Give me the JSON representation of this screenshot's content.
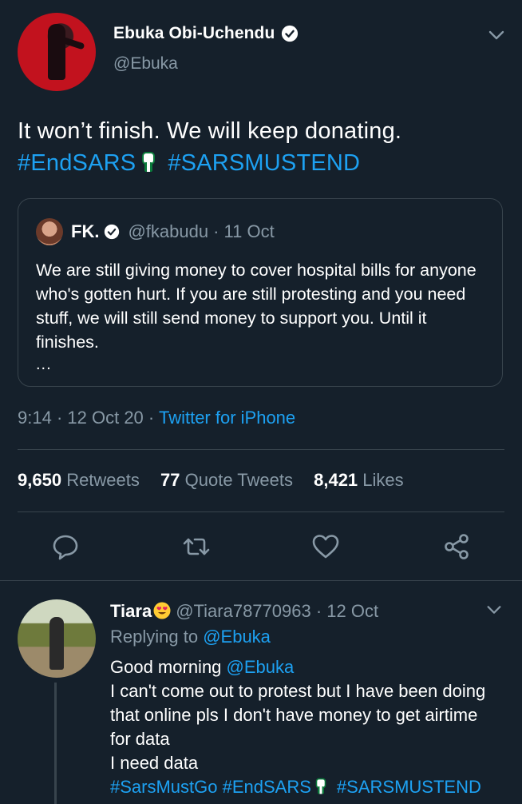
{
  "tweet": {
    "display_name": "Ebuka Obi-Uchendu",
    "handle": "@Ebuka",
    "text_line1": "It won’t finish. We will keep donating.",
    "hashtag1": "#EndSARS",
    "hashtag2": "#SARSMUSTEND",
    "time": "9:14",
    "date": "12 Oct 20",
    "sep": "·",
    "client": "Twitter for iPhone"
  },
  "quote": {
    "name": "FK.",
    "handle": "@fkabudu",
    "date": "· 11 Oct",
    "body": "We are still giving money to cover hospital bills for anyone who's gotten hurt. If you are still protesting and you need stuff, we will still send money to support you. Until it finishes.",
    "ellipsis": "..."
  },
  "stats": {
    "retweets_count": "9,650",
    "retweets_label": "Retweets",
    "quotes_count": "77",
    "quotes_label": "Quote Tweets",
    "likes_count": "8,421",
    "likes_label": "Likes"
  },
  "icons": {
    "reply": "comment-icon",
    "retweet": "retweet-icon",
    "like": "heart-icon",
    "share": "share-icon",
    "verified": "verified-badge-icon",
    "more": "chevron-down-icon"
  },
  "reply": {
    "name": "Tiara",
    "handle": "@Tiara78770963",
    "date": "· 12 Oct",
    "replying_prefix": "Replying to",
    "replying_handle": "@Ebuka",
    "greeting": "Good morning",
    "greeting_handle": "@Ebuka",
    "line2": "I can't come out to protest but I have been doing",
    "line3": "that online pls I don't have money to get airtime",
    "line4": "for data",
    "line5": "I need data",
    "tag1": "#SarsMustGo",
    "tag2": "#EndSARS",
    "tag3": "#SARSMUSTEND"
  },
  "colors": {
    "background": "#15202b",
    "accent": "#1da1f2",
    "muted": "#8899a6",
    "border": "#38444d"
  }
}
